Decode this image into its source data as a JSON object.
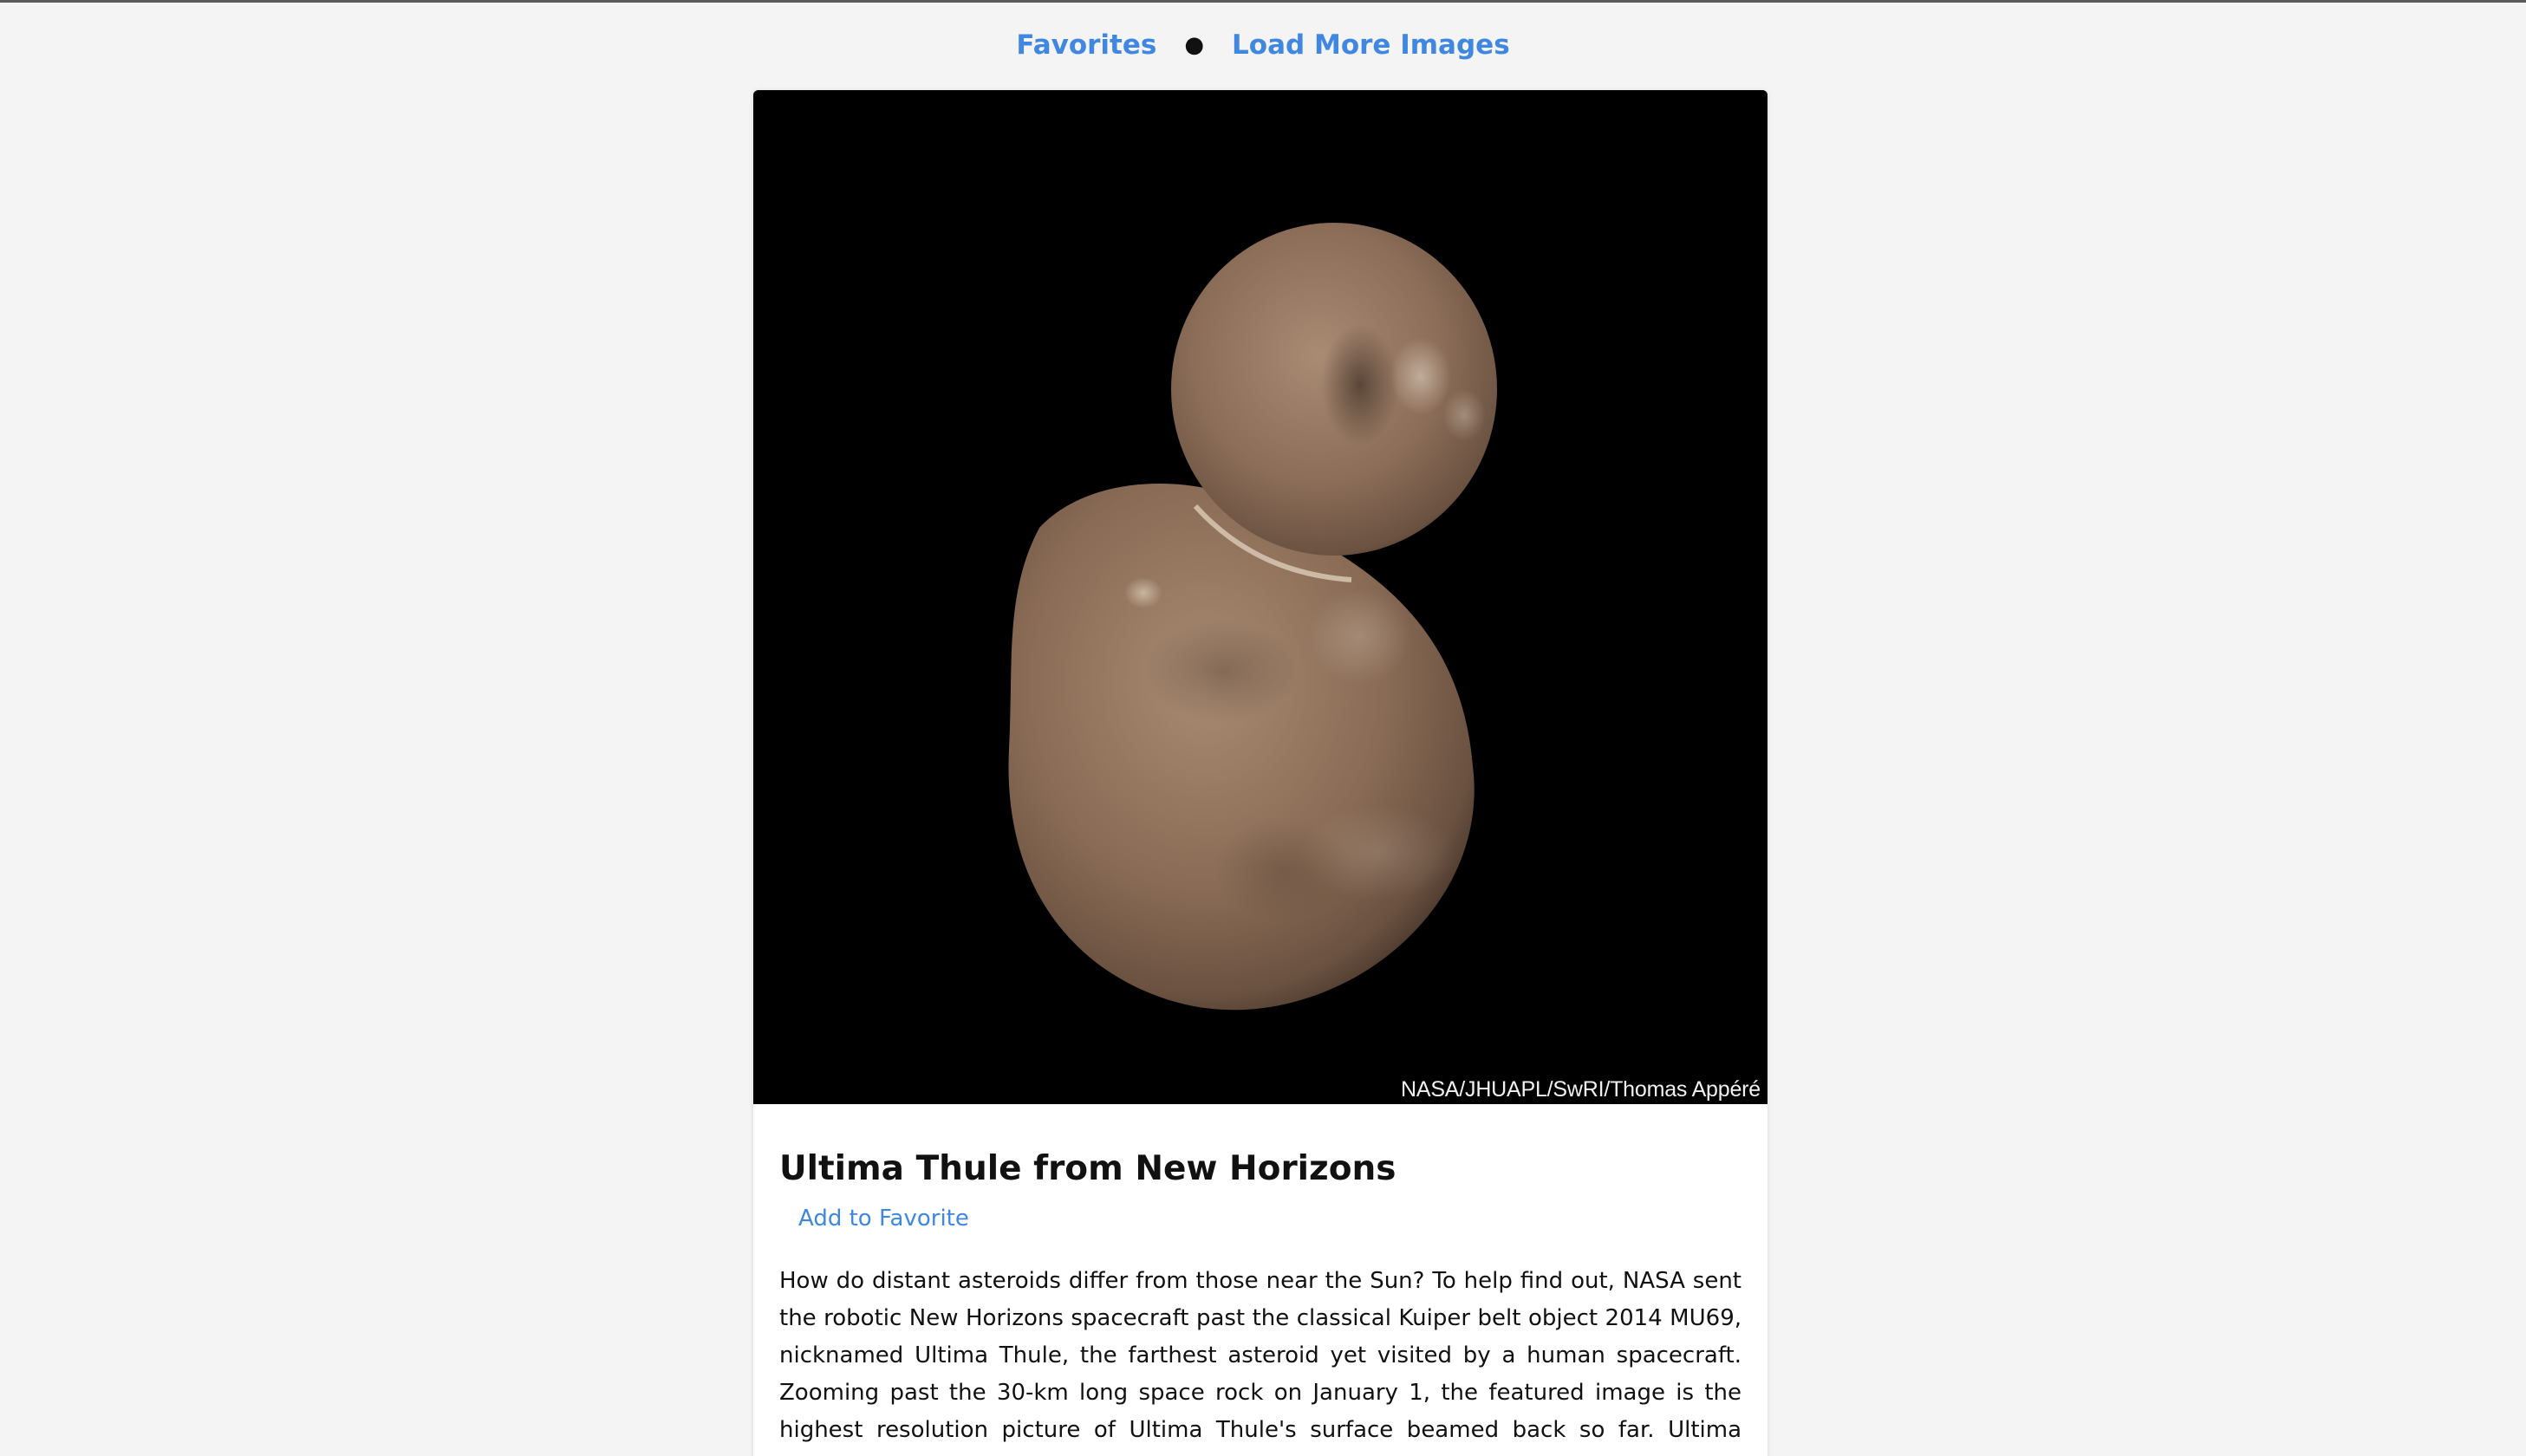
{
  "nav": {
    "favorites_label": "Favorites",
    "separator": "●",
    "load_more_label": "Load More Images"
  },
  "post": {
    "image_alt": "Ultima Thule from New Horizons",
    "image_credit": "NASA/JHUAPL/SwRI/Thomas Appéré",
    "title": "Ultima Thule from New Horizons",
    "add_favorite_label": "Add to Favorite",
    "explanation": "How do distant asteroids differ from those near the Sun? To help find out, NASA sent the robotic New Horizons spacecraft past the classical Kuiper belt object 2014 MU69, nicknamed Ultima Thule, the farthest asteroid yet visited by a human spacecraft. Zooming past the 30-km long space rock on January 1, the featured image is the highest resolution picture of Ultima Thule's surface beamed back so far. Ultima Thule does look different from"
  },
  "colors": {
    "link": "#3f87e0",
    "background": "#f4f4f4",
    "card": "#ffffff",
    "image_background": "#000000"
  }
}
